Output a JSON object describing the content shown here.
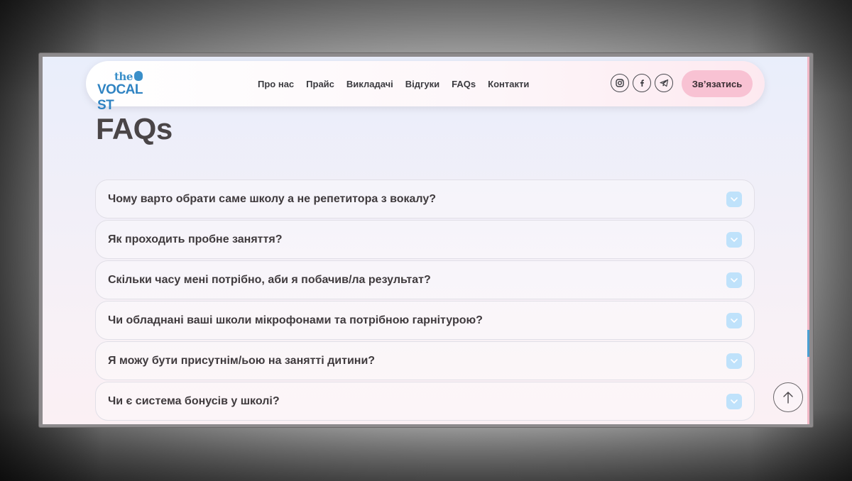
{
  "brand": {
    "logo_small": "the",
    "logo_word": "VOCAL ST"
  },
  "nav": {
    "links": [
      "Про нас",
      "Прайс",
      "Викладачі",
      "Відгуки",
      "FAQs",
      "Контакти"
    ],
    "socials": [
      "instagram-icon",
      "facebook-icon",
      "telegram-icon"
    ],
    "cta_label": "Зв’язатись"
  },
  "page": {
    "title": "FAQs"
  },
  "faq": {
    "items": [
      {
        "question": "Чому варто обрати саме школу а не репетитора з вокалу?"
      },
      {
        "question": "Як проходить пробне заняття?"
      },
      {
        "question": "Скільки часу мені потрібно, аби я побачив/ла результат?"
      },
      {
        "question": "Чи обладнані ваші школи мікрофонами та потрібною гарнітурою?"
      },
      {
        "question": "Я можу бути присутнім/ьою на занятті дитини?"
      },
      {
        "question": "Чи є система бонусів у школі?"
      }
    ]
  },
  "colors": {
    "accent_blue": "#3a8fc9",
    "cta_pink": "#f8c2d3",
    "chevron_bg": "#bfe2fb",
    "text_dark": "#3f3a3d"
  }
}
